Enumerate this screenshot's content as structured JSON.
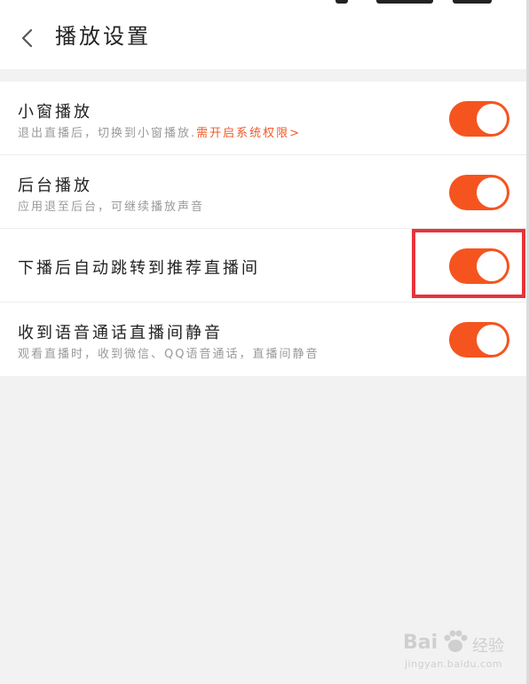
{
  "header": {
    "title": "播放设置",
    "back_icon": "chevron-left-icon"
  },
  "settings": [
    {
      "title": "小窗播放",
      "subtitle": "退出直播后，切换到小窗播放.",
      "subtitle_link": "需开启系统权限>",
      "enabled": true
    },
    {
      "title": "后台播放",
      "subtitle": "应用退至后台，可继续播放声音",
      "enabled": true
    },
    {
      "title": "下播后自动跳转到推荐直播间",
      "enabled": true
    },
    {
      "title": "收到语音通话直播间静音",
      "subtitle": "观看直播时，收到微信、QQ语音通话，直播间静音",
      "enabled": true
    }
  ],
  "colors": {
    "toggle_on": "#f5541f",
    "link": "#f05a28",
    "highlight": "#e8333a"
  },
  "watermark": {
    "brand": "Bai",
    "suffix": "经验",
    "url": "jingyan.baidu.com"
  }
}
